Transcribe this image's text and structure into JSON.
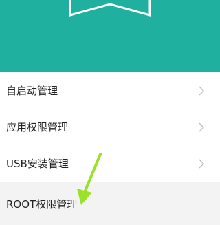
{
  "menu": {
    "items": [
      {
        "label": "自启动管理",
        "icon": "chevron-right-icon"
      },
      {
        "label": "应用权限管理",
        "icon": "chevron-right-icon"
      },
      {
        "label": "USB安装管理",
        "icon": "chevron-right-icon"
      },
      {
        "label": "ROOT权限管理"
      }
    ]
  },
  "colors": {
    "header": "#1fb0a0",
    "highlight_row": "#f2f3f2",
    "annotation_arrow": "#9be02b"
  }
}
